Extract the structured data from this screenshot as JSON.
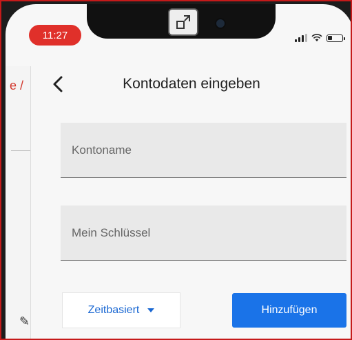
{
  "status_bar": {
    "time": "11:27",
    "signal_bars": 3,
    "battery_level": 0.3
  },
  "background_app": {
    "partial_title": "e /"
  },
  "header": {
    "back_icon": "chevron-left-icon",
    "title": "Kontodaten eingeben"
  },
  "form": {
    "account_name": {
      "value": "",
      "placeholder": "Kontoname"
    },
    "secret_key": {
      "value": "",
      "placeholder": "Mein Schlüssel"
    },
    "type_select": {
      "selected": "Zeitbasiert"
    },
    "add_label": "Hinzufügen"
  },
  "colors": {
    "accent": "#1a73e8",
    "time_pill": "#e0302a",
    "frame_border": "#c51a1a"
  }
}
